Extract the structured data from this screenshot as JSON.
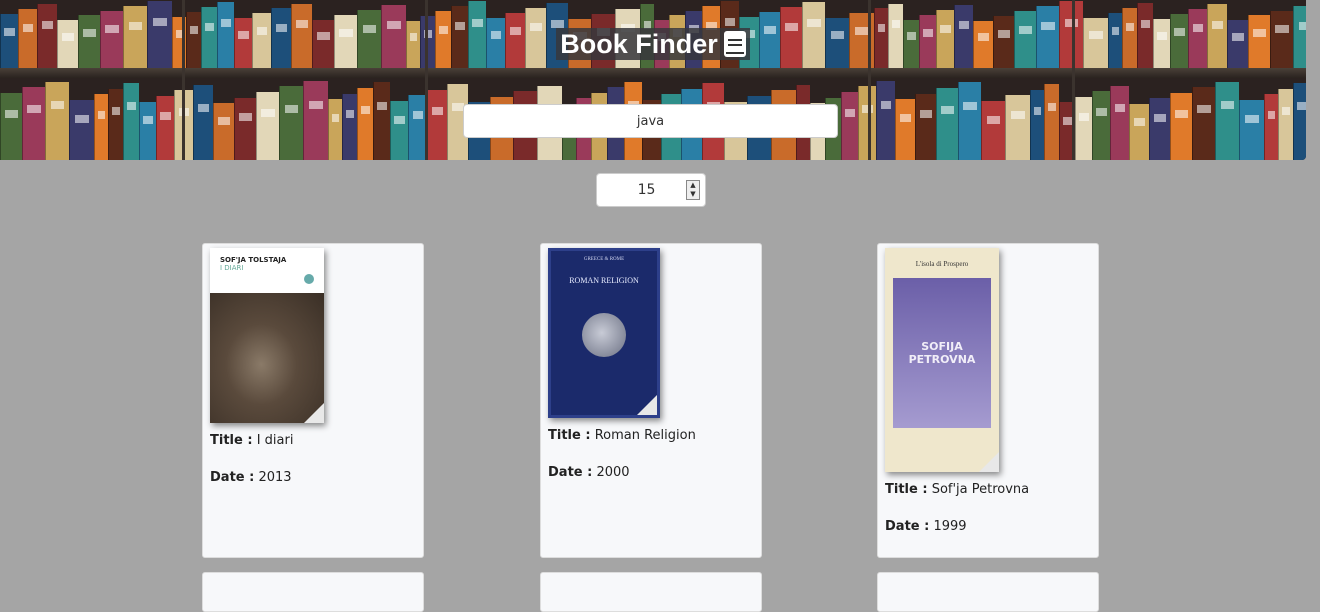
{
  "header": {
    "title": "Book Finder",
    "title_icon": "book-icon"
  },
  "search": {
    "value": "java"
  },
  "results_count": {
    "value": "15"
  },
  "books": [
    {
      "title_label": "Title :",
      "title": "I diari",
      "date_label": "Date :",
      "date": "2013",
      "cover": {
        "author": "SOF'JA TOLSTAJA",
        "title": "I DIARI"
      }
    },
    {
      "title_label": "Title :",
      "title": "Roman Religion",
      "date_label": "Date :",
      "date": "2000",
      "cover": {
        "series": "GREECE & ROME",
        "title": "ROMAN RELIGION"
      }
    },
    {
      "title_label": "Title :",
      "title": "Sof'ja Petrovna",
      "date_label": "Date :",
      "date": "1999",
      "cover": {
        "publisher": "L'isola di Prospero",
        "title": "SOFIJA PETROVNA"
      }
    }
  ],
  "colors": {
    "page_background": "#a5a5a5",
    "card_background": "#f7f8fa"
  }
}
